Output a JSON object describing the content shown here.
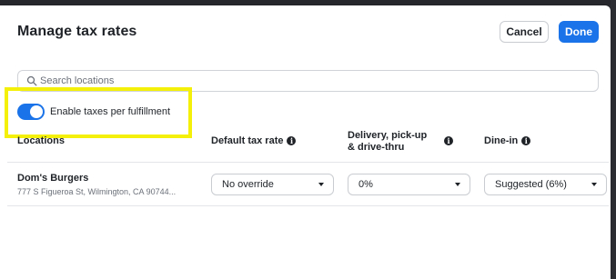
{
  "modal": {
    "title": "Manage tax rates",
    "cancel_label": "Cancel",
    "done_label": "Done",
    "accent_color": "#1a73e8"
  },
  "search": {
    "placeholder": "Search locations",
    "icon": "search-icon"
  },
  "toggle": {
    "label": "Enable taxes per fulfillment",
    "on": true
  },
  "table": {
    "headers": {
      "locations": "Locations",
      "default_tax_rate": "Default tax rate",
      "delivery": "Delivery, pick-up & drive-thru",
      "dine_in": "Dine-in"
    },
    "rows": [
      {
        "name": "Dom's Burgers",
        "address": "777 S Figueroa St, Wilmington, CA 90744...",
        "default_tax_rate": "No override",
        "delivery": "0%",
        "dine_in": "Suggested (6%)"
      }
    ]
  }
}
